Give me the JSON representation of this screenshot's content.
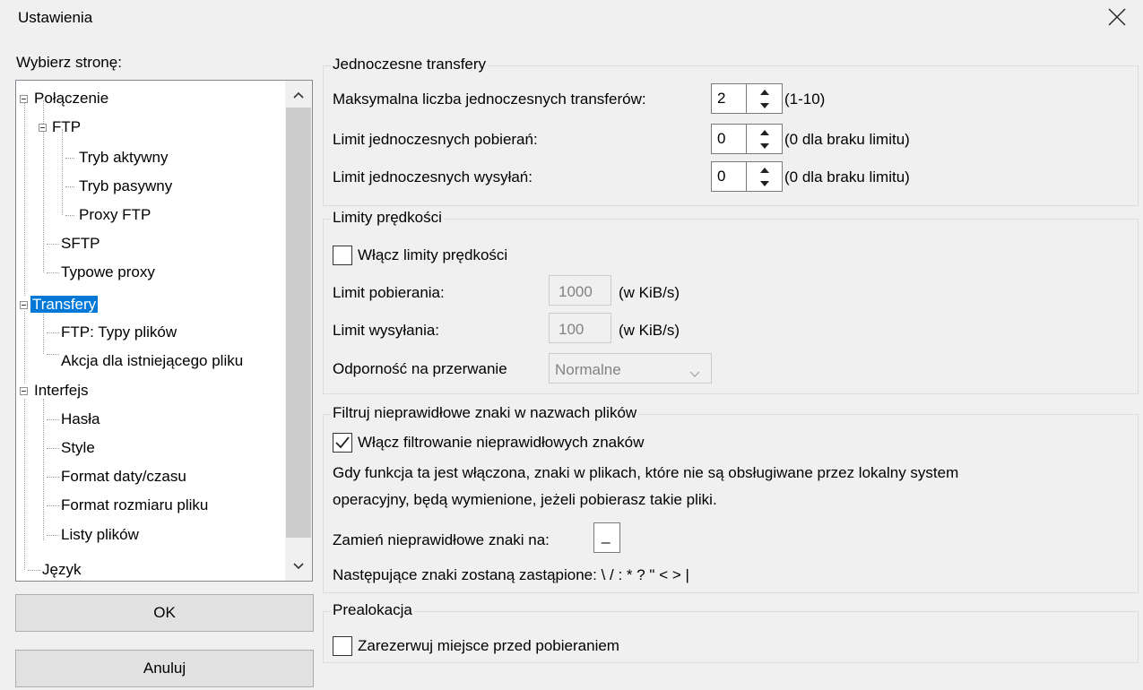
{
  "window": {
    "title": "Ustawienia"
  },
  "left": {
    "label": "Wybierz stronę:",
    "tree": [
      {
        "label": "Połączenie"
      },
      {
        "label": "FTP"
      },
      {
        "label": "Tryb aktywny"
      },
      {
        "label": "Tryb pasywny"
      },
      {
        "label": "Proxy FTP"
      },
      {
        "label": "SFTP"
      },
      {
        "label": "Typowe proxy"
      },
      {
        "label": "Transfery"
      },
      {
        "label": "FTP: Typy plików"
      },
      {
        "label": "Akcja dla istniejącego pliku"
      },
      {
        "label": "Interfejs"
      },
      {
        "label": "Hasła"
      },
      {
        "label": "Style"
      },
      {
        "label": "Format daty/czasu"
      },
      {
        "label": "Format rozmiaru pliku"
      },
      {
        "label": "Listy plików"
      },
      {
        "label": "Język"
      }
    ],
    "selected": "Transfery",
    "ok_label": "OK",
    "cancel_label": "Anuluj"
  },
  "concurrent": {
    "title": "Jednoczesne transfery",
    "max_label": "Maksymalna liczba jednoczesnych transferów:",
    "max_value": "2",
    "max_hint": "(1-10)",
    "down_label": "Limit jednoczesnych pobierań:",
    "down_value": "0",
    "down_hint": "(0 dla braku limitu)",
    "up_label": "Limit jednoczesnych wysyłań:",
    "up_value": "0",
    "up_hint": "(0 dla braku limitu)"
  },
  "speed": {
    "title": "Limity prędkości",
    "enable_label": "Włącz limity prędkości",
    "enable_checked": false,
    "download_label": "Limit pobierania:",
    "download_value": "1000",
    "download_unit": "(w KiB/s)",
    "upload_label": "Limit wysyłania:",
    "upload_value": "100",
    "upload_unit": "(w KiB/s)",
    "burst_label": "Odporność na przerwanie",
    "burst_value": "Normalne"
  },
  "filter": {
    "title": "Filtruj nieprawidłowe znaki w nazwach plików",
    "enable_label": "Włącz filtrowanie nieprawidłowych znaków",
    "enable_checked": true,
    "desc_line1": "Gdy funkcja ta jest włączona, znaki w plikach, które nie są obsługiwane przez lokalny system",
    "desc_line2": "operacyjny, będą wymienione, jeżeli pobierasz takie pliki.",
    "replace_label": "Zamień nieprawidłowe znaki na:",
    "replace_value": "_",
    "replaced_chars": "Następujące znaki zostaną zastąpione: \\ / : * ? \" < > |"
  },
  "prealloc": {
    "title": "Prealokacja",
    "reserve_label": "Zarezerwuj miejsce przed pobieraniem",
    "reserve_checked": false
  },
  "colors": {
    "selection": "#0078d7",
    "background": "#f0f0f0"
  }
}
